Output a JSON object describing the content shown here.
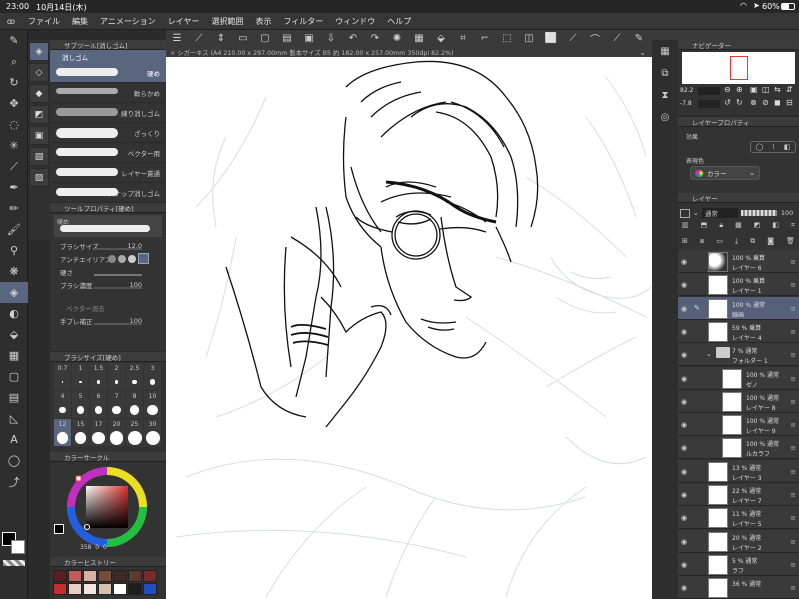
{
  "status": {
    "time": "23:00",
    "date": "10月14日(木)",
    "battery": "60%"
  },
  "menu": [
    "ファイル",
    "編集",
    "アニメーション",
    "レイヤー",
    "選択範囲",
    "表示",
    "フィルター",
    "ウィンドウ",
    "ヘルプ"
  ],
  "canvas_tab": "× シガーキス (A4 210.00 x 297.00mm 製本サイズ B5 約 182.00 x 257.00mm 350dpi 82.2%)",
  "subtool": {
    "title": "サブツール[消しゴム]",
    "group": "消しゴム",
    "items": [
      "硬め",
      "軟らかめ",
      "練り消しゴム",
      "ざっくり",
      "ベクター用",
      "レイヤー貫通",
      "スナップ消しゴム"
    ]
  },
  "toolprop": {
    "title": "ツールプロパティ[硬め]",
    "name": "硬め",
    "brush_size_label": "ブラシサイズ",
    "brush_size": "12.0",
    "antialias_label": "アンチエイリアス",
    "hardness_label": "硬さ",
    "density_label": "ブラシ濃度",
    "density": "100",
    "vector_label": "ベクター消去",
    "stabilize_label": "手ブレ補正",
    "stabilize": "100"
  },
  "brushsize": {
    "title": "ブラシサイズ[硬め]",
    "sizes": [
      "0.7",
      "1",
      "1.5",
      "2",
      "2.5",
      "3",
      "4",
      "5",
      "6",
      "7",
      "8",
      "10",
      "12",
      "15",
      "17",
      "20",
      "25",
      "30"
    ]
  },
  "colorcircle": {
    "title": "カラーサークル",
    "value": "358",
    "s": "0",
    "v": "0"
  },
  "history": {
    "title": "カラーヒストリー",
    "colors": [
      "#5a1e1e",
      "#c25a5a",
      "#d9b0a0",
      "#7b4b3a",
      "#3a2b1e",
      "#5a3a2a",
      "#7a2a2a",
      "#c23030",
      "#e8d0c8",
      "#f0e6dc",
      "#d8c0b0",
      "#ffffff",
      "#1e1e1e",
      "#2050c0"
    ]
  },
  "navigator": {
    "title": "ナビゲーター",
    "zoom": "82.2",
    "angle": "-7.8"
  },
  "layerprop": {
    "title": "レイヤープロパティ",
    "effect_label": "効果",
    "color_label": "表現色",
    "color_value": "カラー"
  },
  "layers": {
    "title": "レイヤー",
    "blend": "通常",
    "opacity": "100",
    "items": [
      {
        "line1": "100 % 乗算",
        "line2": "レイヤー 6",
        "indent": 0,
        "selected": false,
        "dark": true
      },
      {
        "line1": "100 % 乗算",
        "line2": "レイヤー 1",
        "indent": 0,
        "selected": false,
        "dark": false
      },
      {
        "line1": "100 % 通常",
        "line2": "線画",
        "indent": 0,
        "selected": true,
        "dark": false
      },
      {
        "line1": "59 % 乗算",
        "line2": "レイヤー 4",
        "indent": 0,
        "selected": false,
        "dark": false
      },
      {
        "line1": "7 % 通常",
        "line2": "フォルダー 1",
        "indent": 0,
        "selected": false,
        "folder": true
      },
      {
        "line1": "100 % 通常",
        "line2": "ゼノ",
        "indent": 1,
        "selected": false,
        "dark": false
      },
      {
        "line1": "100 % 通常",
        "line2": "レイヤー 8",
        "indent": 1,
        "selected": false,
        "dark": false
      },
      {
        "line1": "100 % 通常",
        "line2": "レイヤー 9",
        "indent": 1,
        "selected": false,
        "dark": false
      },
      {
        "line1": "100 % 通常",
        "line2": "ルカラフ",
        "indent": 1,
        "selected": false,
        "dark": false
      },
      {
        "line1": "13 % 通常",
        "line2": "レイヤー 3",
        "indent": 0,
        "selected": false,
        "dark": false
      },
      {
        "line1": "22 % 通常",
        "line2": "レイヤー 7",
        "indent": 0,
        "selected": false,
        "dark": false
      },
      {
        "line1": "11 % 通常",
        "line2": "レイヤー 5",
        "indent": 0,
        "selected": false,
        "dark": false
      },
      {
        "line1": "20 % 通常",
        "line2": "レイヤー 2",
        "indent": 0,
        "selected": false,
        "dark": false
      },
      {
        "line1": "5 % 通常",
        "line2": "ラフ",
        "indent": 0,
        "selected": false,
        "dark": false
      },
      {
        "line1": "36 % 通常",
        "line2": "",
        "indent": 0,
        "selected": false,
        "dark": false
      }
    ]
  }
}
